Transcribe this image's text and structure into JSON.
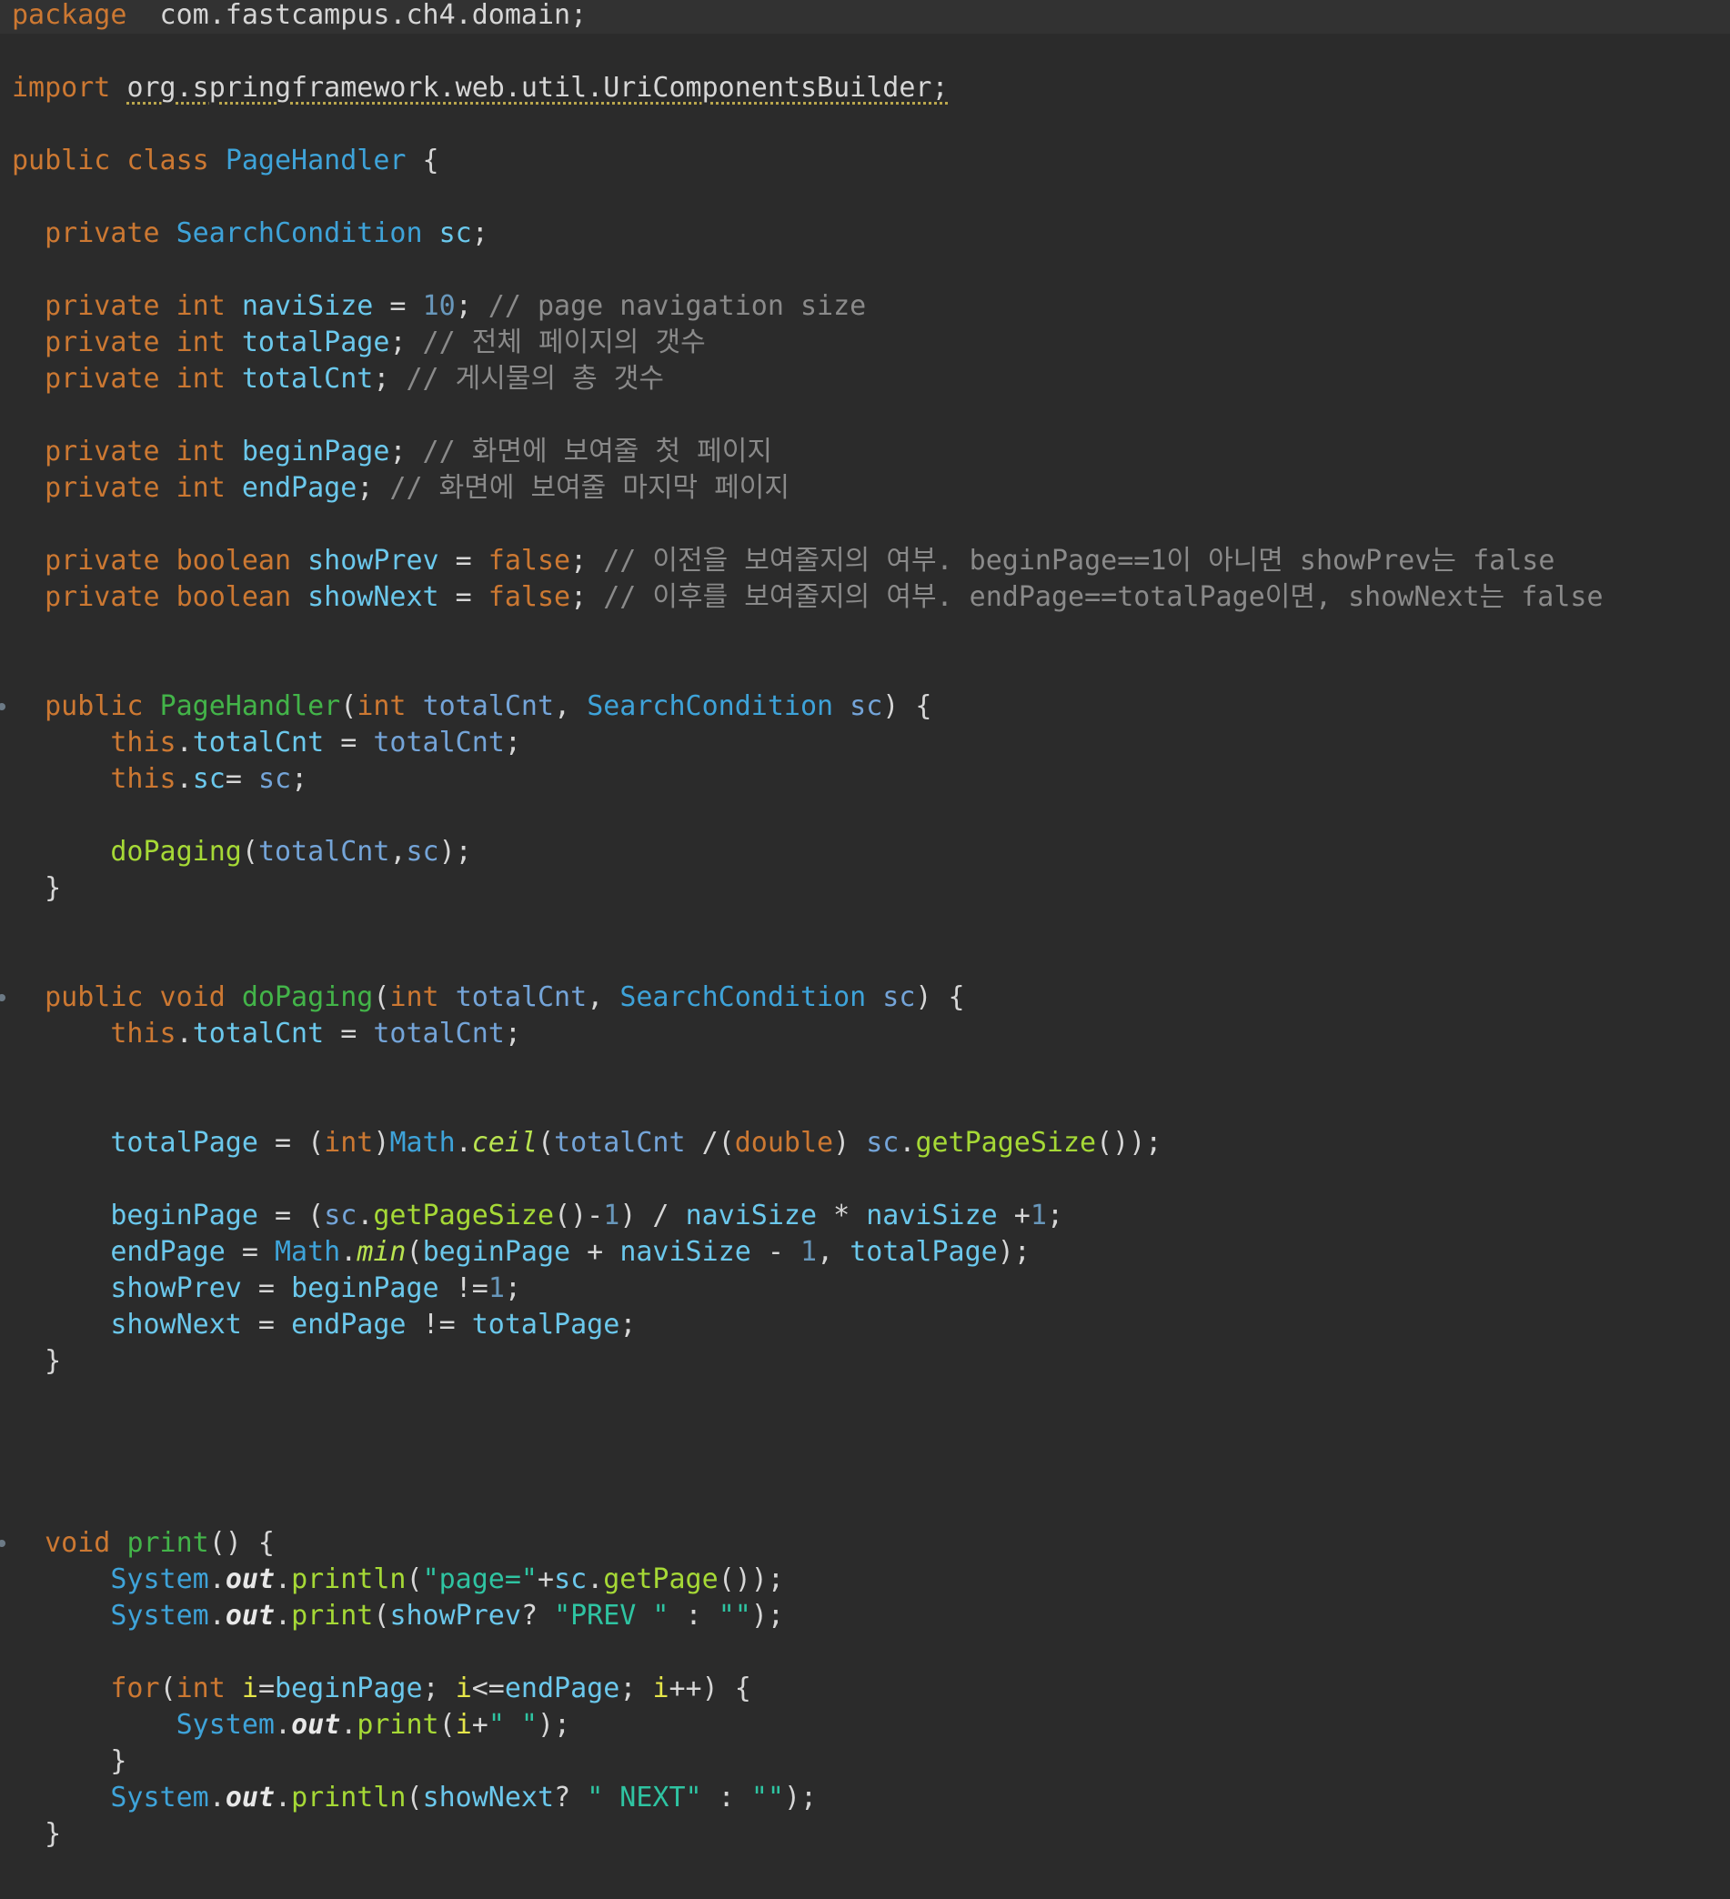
{
  "editor": {
    "language": "java",
    "theme_colors": {
      "background": "#2b2b2b",
      "keyword": "#cc7832",
      "type": "#3ea3d9",
      "field": "#6bc8ec",
      "parameter": "#74a4d8",
      "number": "#6897bb",
      "comment": "#8a8a8a",
      "method_declaration": "#43b449",
      "method_call": "#a6d936",
      "string": "#2fc4a2"
    },
    "lines": [
      [
        [
          "kw",
          "package"
        ],
        [
          "",
          "  com.fastcampus.ch4.domain;"
        ]
      ],
      [],
      [
        [
          "kw",
          "import "
        ],
        [
          "wavy",
          "org.springframework.web.util.UriComponentsBuilder;"
        ]
      ],
      [],
      [
        [
          "kw",
          "public class "
        ],
        [
          "cls",
          "PageHandler"
        ],
        [
          "",
          " {"
        ]
      ],
      [],
      [
        [
          "",
          "  "
        ],
        [
          "kw",
          "private "
        ],
        [
          "cls",
          "SearchCondition "
        ],
        [
          "fld",
          "sc"
        ],
        [
          "",
          ";"
        ]
      ],
      [],
      [
        [
          "",
          "  "
        ],
        [
          "kw",
          "private int "
        ],
        [
          "fld",
          "naviSize"
        ],
        [
          "",
          " = "
        ],
        [
          "num",
          "10"
        ],
        [
          "",
          ";"
        ],
        [
          "cm",
          " // page navigation size"
        ]
      ],
      [
        [
          "",
          "  "
        ],
        [
          "kw",
          "private int "
        ],
        [
          "fld",
          "totalPage"
        ],
        [
          "",
          ";"
        ],
        [
          "cm",
          " // 전체 페이지의 갯수"
        ]
      ],
      [
        [
          "",
          "  "
        ],
        [
          "kw",
          "private int "
        ],
        [
          "fld",
          "totalCnt"
        ],
        [
          "",
          ";"
        ],
        [
          "cm",
          " // 게시물의 총 갯수"
        ]
      ],
      [],
      [
        [
          "",
          "  "
        ],
        [
          "kw",
          "private int "
        ],
        [
          "fld",
          "beginPage"
        ],
        [
          "",
          ";"
        ],
        [
          "cm",
          " // 화면에 보여줄 첫 페이지"
        ]
      ],
      [
        [
          "",
          "  "
        ],
        [
          "kw",
          "private int "
        ],
        [
          "fld",
          "endPage"
        ],
        [
          "",
          ";"
        ],
        [
          "cm",
          " // 화면에 보여줄 마지막 페이지"
        ]
      ],
      [],
      [
        [
          "",
          "  "
        ],
        [
          "kw",
          "private boolean "
        ],
        [
          "fld",
          "showPrev"
        ],
        [
          "",
          " = "
        ],
        [
          "kw",
          "false"
        ],
        [
          "",
          ";"
        ],
        [
          "cm",
          " // 이전을 보여줄지의 여부. beginPage==1이 아니면 showPrev는 false"
        ]
      ],
      [
        [
          "",
          "  "
        ],
        [
          "kw",
          "private boolean "
        ],
        [
          "fld",
          "showNext"
        ],
        [
          "",
          " = "
        ],
        [
          "kw",
          "false"
        ],
        [
          "",
          ";"
        ],
        [
          "cm",
          " // 이후를 보여줄지의 여부. endPage==totalPage이면, showNext는 false"
        ]
      ],
      [],
      [],
      [
        [
          "",
          "  "
        ],
        [
          "kw",
          "public "
        ],
        [
          "dfn",
          "PageHandler"
        ],
        [
          "",
          "("
        ],
        [
          "kw",
          "int "
        ],
        [
          "par",
          "totalCnt"
        ],
        [
          "",
          ", "
        ],
        [
          "cls",
          "SearchCondition "
        ],
        [
          "par",
          "sc"
        ],
        [
          "",
          ") {"
        ]
      ],
      [
        [
          "",
          "      "
        ],
        [
          "kw",
          "this"
        ],
        [
          "",
          "."
        ],
        [
          "fld",
          "totalCnt"
        ],
        [
          "",
          " = "
        ],
        [
          "par",
          "totalCnt"
        ],
        [
          "",
          ";"
        ]
      ],
      [
        [
          "",
          "      "
        ],
        [
          "kw",
          "this"
        ],
        [
          "",
          "."
        ],
        [
          "fld",
          "sc"
        ],
        [
          "",
          "= "
        ],
        [
          "par",
          "sc"
        ],
        [
          "",
          ";"
        ]
      ],
      [],
      [
        [
          "",
          "      "
        ],
        [
          "mcall",
          "doPaging"
        ],
        [
          "",
          "("
        ],
        [
          "par",
          "totalCnt"
        ],
        [
          "",
          ","
        ],
        [
          "par",
          "sc"
        ],
        [
          "",
          ");"
        ]
      ],
      [
        [
          "",
          "  }"
        ]
      ],
      [],
      [],
      [
        [
          "",
          "  "
        ],
        [
          "kw",
          "public void "
        ],
        [
          "dfn",
          "doPaging"
        ],
        [
          "",
          "("
        ],
        [
          "kw",
          "int "
        ],
        [
          "par",
          "totalCnt"
        ],
        [
          "",
          ", "
        ],
        [
          "cls",
          "SearchCondition "
        ],
        [
          "par",
          "sc"
        ],
        [
          "",
          ") {"
        ]
      ],
      [
        [
          "",
          "      "
        ],
        [
          "kw",
          "this"
        ],
        [
          "",
          "."
        ],
        [
          "fld",
          "totalCnt"
        ],
        [
          "",
          " = "
        ],
        [
          "par",
          "totalCnt"
        ],
        [
          "",
          ";"
        ]
      ],
      [],
      [],
      [
        [
          "",
          "      "
        ],
        [
          "fld",
          "totalPage"
        ],
        [
          "",
          " = ("
        ],
        [
          "kw",
          "int"
        ],
        [
          "",
          ")"
        ],
        [
          "cls",
          "Math"
        ],
        [
          "",
          "."
        ],
        [
          "stat",
          "ceil"
        ],
        [
          "",
          "("
        ],
        [
          "par",
          "totalCnt"
        ],
        [
          "",
          " /("
        ],
        [
          "kw",
          "double"
        ],
        [
          "",
          ") "
        ],
        [
          "par",
          "sc"
        ],
        [
          "",
          "."
        ],
        [
          "mcall",
          "getPageSize"
        ],
        [
          "",
          "());"
        ]
      ],
      [],
      [
        [
          "",
          "      "
        ],
        [
          "fld",
          "beginPage"
        ],
        [
          "",
          " = ("
        ],
        [
          "par",
          "sc"
        ],
        [
          "",
          "."
        ],
        [
          "mcall",
          "getPageSize"
        ],
        [
          "",
          "()-"
        ],
        [
          "num",
          "1"
        ],
        [
          "",
          ") / "
        ],
        [
          "fld",
          "naviSize"
        ],
        [
          "",
          " * "
        ],
        [
          "fld",
          "naviSize"
        ],
        [
          "",
          " +"
        ],
        [
          "num",
          "1"
        ],
        [
          "",
          ";"
        ]
      ],
      [
        [
          "",
          "      "
        ],
        [
          "fld",
          "endPage"
        ],
        [
          "",
          " = "
        ],
        [
          "cls",
          "Math"
        ],
        [
          "",
          "."
        ],
        [
          "stat",
          "min"
        ],
        [
          "",
          "("
        ],
        [
          "fld",
          "beginPage"
        ],
        [
          "",
          " + "
        ],
        [
          "fld",
          "naviSize"
        ],
        [
          "",
          " - "
        ],
        [
          "num",
          "1"
        ],
        [
          "",
          ", "
        ],
        [
          "fld",
          "totalPage"
        ],
        [
          "",
          ");"
        ]
      ],
      [
        [
          "",
          "      "
        ],
        [
          "fld",
          "showPrev"
        ],
        [
          "",
          " = "
        ],
        [
          "fld",
          "beginPage"
        ],
        [
          "",
          " !="
        ],
        [
          "num",
          "1"
        ],
        [
          "",
          ";"
        ]
      ],
      [
        [
          "",
          "      "
        ],
        [
          "fld",
          "showNext"
        ],
        [
          "",
          " = "
        ],
        [
          "fld",
          "endPage"
        ],
        [
          "",
          " != "
        ],
        [
          "fld",
          "totalPage"
        ],
        [
          "",
          ";"
        ]
      ],
      [
        [
          "",
          "  }"
        ]
      ],
      [],
      [],
      [],
      [],
      [
        [
          "",
          "  "
        ],
        [
          "kw",
          "void "
        ],
        [
          "dfn",
          "print"
        ],
        [
          "",
          "() {"
        ]
      ],
      [
        [
          "",
          "      "
        ],
        [
          "cls",
          "System"
        ],
        [
          "",
          "."
        ],
        [
          "outk",
          "out"
        ],
        [
          "",
          "."
        ],
        [
          "mcall",
          "println"
        ],
        [
          "",
          "("
        ],
        [
          "str",
          "\"page=\""
        ],
        [
          "",
          "+"
        ],
        [
          "fld",
          "sc"
        ],
        [
          "",
          "."
        ],
        [
          "mcall",
          "getPage"
        ],
        [
          "",
          "());"
        ]
      ],
      [
        [
          "",
          "      "
        ],
        [
          "cls",
          "System"
        ],
        [
          "",
          "."
        ],
        [
          "outk",
          "out"
        ],
        [
          "",
          "."
        ],
        [
          "mcall",
          "print"
        ],
        [
          "",
          "("
        ],
        [
          "fld",
          "showPrev"
        ],
        [
          "",
          "? "
        ],
        [
          "str",
          "\"PREV \""
        ],
        [
          "",
          " : "
        ],
        [
          "str",
          "\"\""
        ],
        [
          "",
          ");"
        ]
      ],
      [],
      [
        [
          "",
          "      "
        ],
        [
          "kw",
          "for"
        ],
        [
          "",
          "("
        ],
        [
          "kw",
          "int "
        ],
        [
          "loc",
          "i"
        ],
        [
          "",
          "="
        ],
        [
          "fld",
          "beginPage"
        ],
        [
          "",
          "; "
        ],
        [
          "loc",
          "i"
        ],
        [
          "",
          "<="
        ],
        [
          "fld",
          "endPage"
        ],
        [
          "",
          "; "
        ],
        [
          "loc",
          "i"
        ],
        [
          "",
          "++) {"
        ]
      ],
      [
        [
          "",
          "          "
        ],
        [
          "cls",
          "System"
        ],
        [
          "",
          "."
        ],
        [
          "outk",
          "out"
        ],
        [
          "",
          "."
        ],
        [
          "mcall",
          "print"
        ],
        [
          "",
          "("
        ],
        [
          "loc",
          "i"
        ],
        [
          "",
          "+"
        ],
        [
          "str",
          "\" \""
        ],
        [
          "",
          ");"
        ]
      ],
      [
        [
          "",
          "      }"
        ]
      ],
      [
        [
          "",
          "      "
        ],
        [
          "cls",
          "System"
        ],
        [
          "",
          "."
        ],
        [
          "outk",
          "out"
        ],
        [
          "",
          "."
        ],
        [
          "mcall",
          "println"
        ],
        [
          "",
          "("
        ],
        [
          "fld",
          "showNext"
        ],
        [
          "",
          "? "
        ],
        [
          "str",
          "\" NEXT\""
        ],
        [
          "",
          " : "
        ],
        [
          "str",
          "\"\""
        ],
        [
          "",
          ");"
        ]
      ],
      [
        [
          "",
          "  }"
        ]
      ]
    ],
    "fold_marker_lines": [
      19,
      27,
      42
    ]
  }
}
